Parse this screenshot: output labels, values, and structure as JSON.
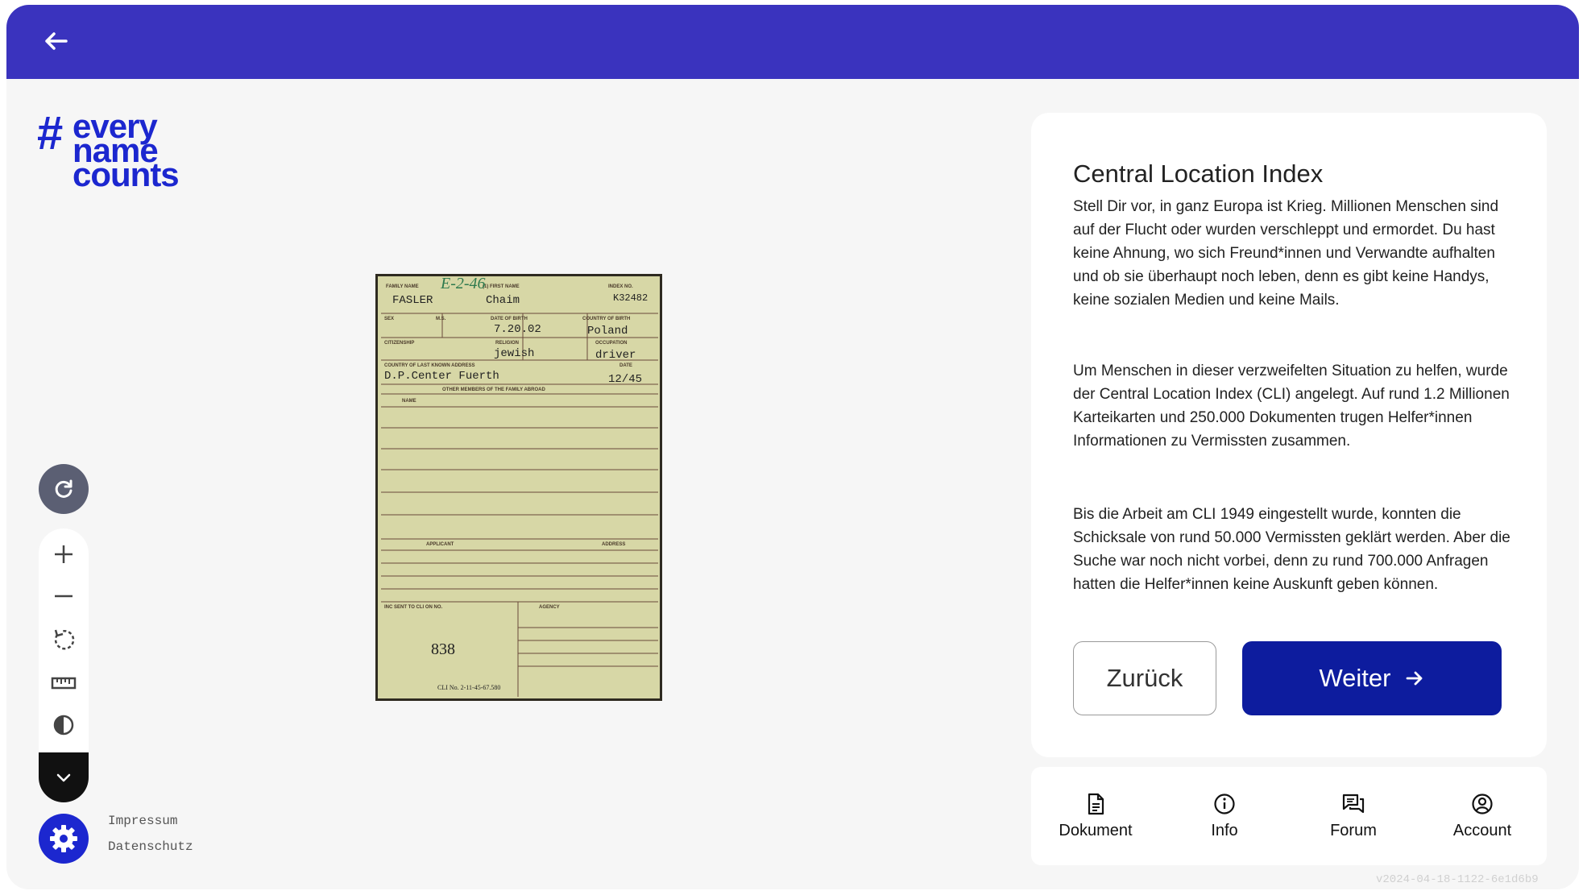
{
  "header": {
    "back_icon": "arrow-left-icon",
    "bar_color": "#3a33be"
  },
  "logo": {
    "hash": "#",
    "line1": "every",
    "line2": "name",
    "line3": "counts",
    "color": "#1c27cf"
  },
  "document_card": {
    "handwritten_number": "E-2-46",
    "family_name": "FASLER",
    "first_name": "Chaim",
    "index_no": "K32482",
    "date_of_birth": "7.20.02",
    "country_of_birth": "Poland",
    "religion": "jewish",
    "occupation": "driver",
    "last_known_address": "D.P.Center Fuerth",
    "date": "12/45",
    "cli_no": "838",
    "footer_print": "CLI No. 2-11-45-67.580",
    "labels": {
      "family_name": "FAMILY NAME",
      "first_name": "(1) FIRST NAME",
      "index_no": "INDEX NO.",
      "sex": "SEX",
      "ms": "M.S.",
      "dob": "DATE OF BIRTH",
      "cob": "COUNTRY OF BIRTH",
      "citizenship": "CITIZENSHIP",
      "religion": "RELIGION",
      "occupation": "OCCUPATION",
      "address": "COUNTRY OF LAST KNOWN ADDRESS",
      "date": "DATE",
      "other_members": "OTHER MEMBERS OF THE FAMILY ABROAD",
      "name": "NAME",
      "applicant": "APPLICANT",
      "address_short": "ADDRESS",
      "sent": "INC SENT TO CLI ON NO.",
      "agency": "AGENCY"
    }
  },
  "toolbar": {
    "reset_icon": "refresh-icon",
    "zoom_in_icon": "plus-icon",
    "zoom_out_icon": "minus-icon",
    "rotate_icon": "rotate-icon",
    "ruler_icon": "ruler-icon",
    "contrast_icon": "contrast-icon",
    "collapse_icon": "chevron-down-icon",
    "settings_icon": "gear-icon"
  },
  "footer": {
    "impressum": "Impressum",
    "datenschutz": "Datenschutz",
    "version": "v2024-04-18-1122-6e1d6b9"
  },
  "info": {
    "title": "Central Location Index",
    "paragraph1": "Stell Dir vor, in ganz Europa ist Krieg. Millionen Menschen sind auf der Flucht oder wurden verschleppt und ermordet. Du hast keine Ahnung, wo sich Freund*innen und Verwandte aufhalten und ob sie überhaupt noch leben, denn es gibt keine Handys, keine sozialen Medien und keine Mails.",
    "paragraph2": "Um Menschen in dieser verzweifelten Situation zu helfen, wurde der Central Location Index (CLI) angelegt. Auf rund 1.2 Millionen Karteikarten und 250.000 Dokumenten trugen Helfer*innen Informationen zu Vermissten zusammen.",
    "paragraph3": "Bis die Arbeit am CLI 1949 eingestellt wurde, konnten die Schicksale von rund 50.000 Vermissten geklärt werden. Aber die Suche war noch nicht vorbei, denn zu rund 700.000 Anfragen hatten die Helfer*innen keine Auskunft geben können.",
    "back_label": "Zurück",
    "next_label": "Weiter",
    "next_icon": "arrow-right-icon"
  },
  "bottom_nav": [
    {
      "label": "Dokument",
      "icon": "document-icon"
    },
    {
      "label": "Info",
      "icon": "info-icon"
    },
    {
      "label": "Forum",
      "icon": "forum-icon"
    },
    {
      "label": "Account",
      "icon": "account-icon"
    }
  ]
}
